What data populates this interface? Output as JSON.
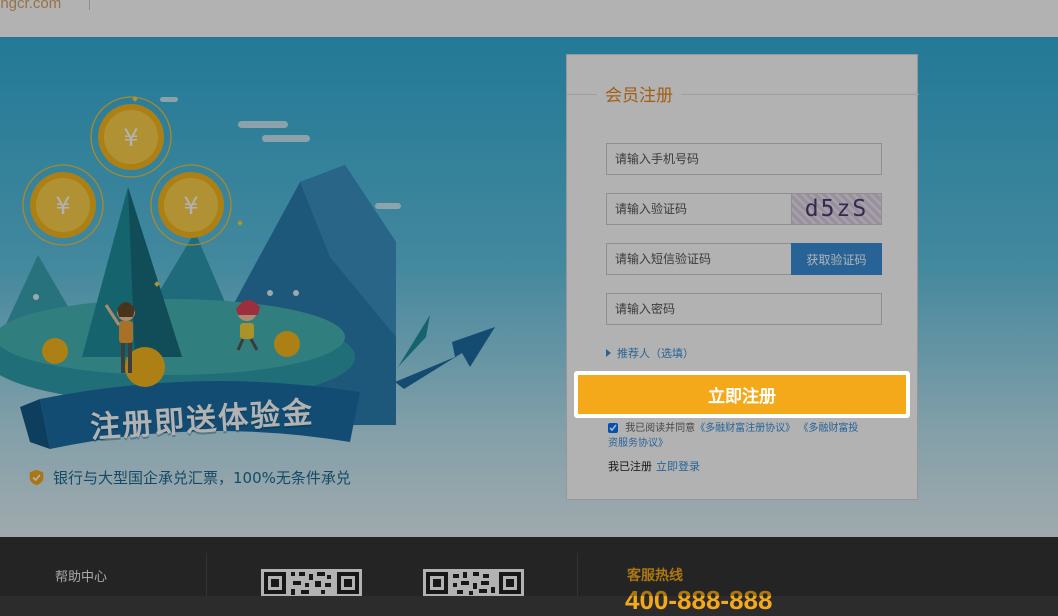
{
  "header": {
    "logo_text": "ongcr.com"
  },
  "hero": {
    "slogan": "注册即送体验金",
    "guarantee": "银行与大型国企承兑汇票，100%无条件承兑",
    "coin_symbol": "¥"
  },
  "form": {
    "title": "会员注册",
    "phone_placeholder": "请输入手机号码",
    "captcha_placeholder": "请输入验证码",
    "captcha_text": "d5zS",
    "sms_placeholder": "请输入短信验证码",
    "sms_button": "获取验证码",
    "password_placeholder": "请输入密码",
    "referrer_label": "推荐人（选填）",
    "submit_label": "立即注册",
    "agree_prefix": "我已阅读并同意",
    "agreement_1": "《多融财富注册协议》",
    "agreement_2": "《多融财富投资服务协议》",
    "login_prompt": "我已注册",
    "login_link": "立即登录"
  },
  "footer": {
    "help_center": "帮助中心",
    "hotline_label": "客服热线",
    "phone": "400-888-888"
  },
  "colors": {
    "accent": "#f4a91a",
    "title": "#e8871e",
    "link": "#3a8fd9",
    "hero_top": "#33aed8"
  }
}
